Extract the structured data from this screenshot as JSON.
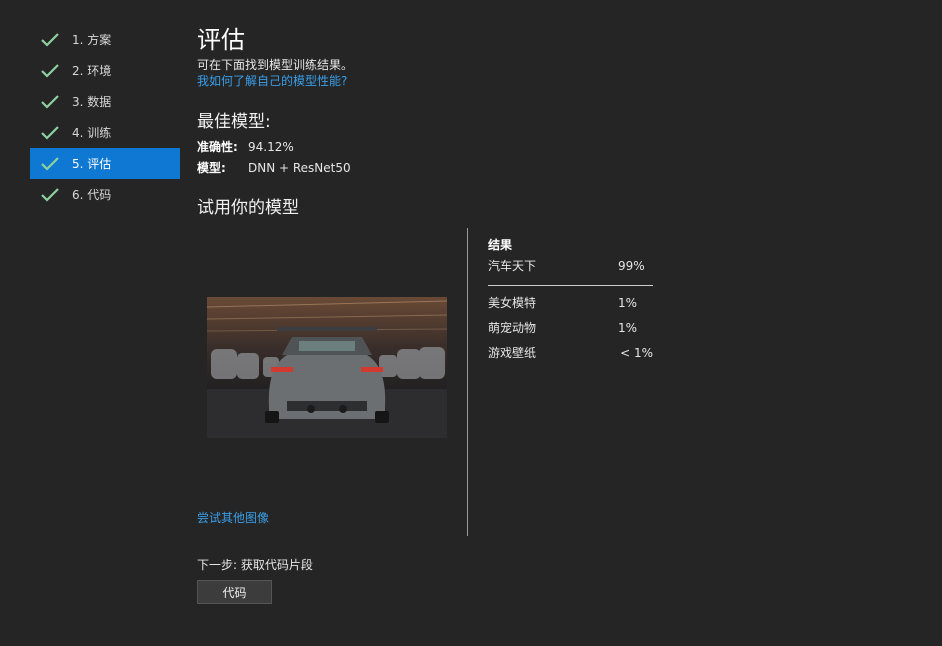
{
  "steps": [
    {
      "label": "1. 方案",
      "done": true
    },
    {
      "label": "2. 环境",
      "done": true
    },
    {
      "label": "3. 数据",
      "done": true
    },
    {
      "label": "4. 训练",
      "done": true
    },
    {
      "label": "5. 评估",
      "done": true,
      "active": true
    },
    {
      "label": "6. 代码",
      "done": true
    }
  ],
  "page": {
    "title": "评估",
    "subtitle": "可在下面找到模型训练结果。",
    "help_link": "我如何了解自己的模型性能?"
  },
  "best_model": {
    "heading": "最佳模型:",
    "accuracy_label": "准确性:",
    "accuracy_value": "94.12%",
    "model_label": "模型:",
    "model_value": "DNN + ResNet50"
  },
  "try_model": {
    "heading": "试用你的模型",
    "try_other_link": "尝试其他图像"
  },
  "results": {
    "title": "结果",
    "top": {
      "label": "汽车天下",
      "pct": "99%"
    },
    "others": [
      {
        "label": "美女模特",
        "pct": "1%"
      },
      {
        "label": "萌宠动物",
        "pct": "1%"
      },
      {
        "label": "游戏壁纸",
        "pct": "< 1%"
      }
    ]
  },
  "next": {
    "text": "下一步: 获取代码片段",
    "button": "代码"
  },
  "colors": {
    "accent": "#0e78d2",
    "link": "#3a9ee8",
    "check": "#8fd19e",
    "background": "#252526"
  }
}
